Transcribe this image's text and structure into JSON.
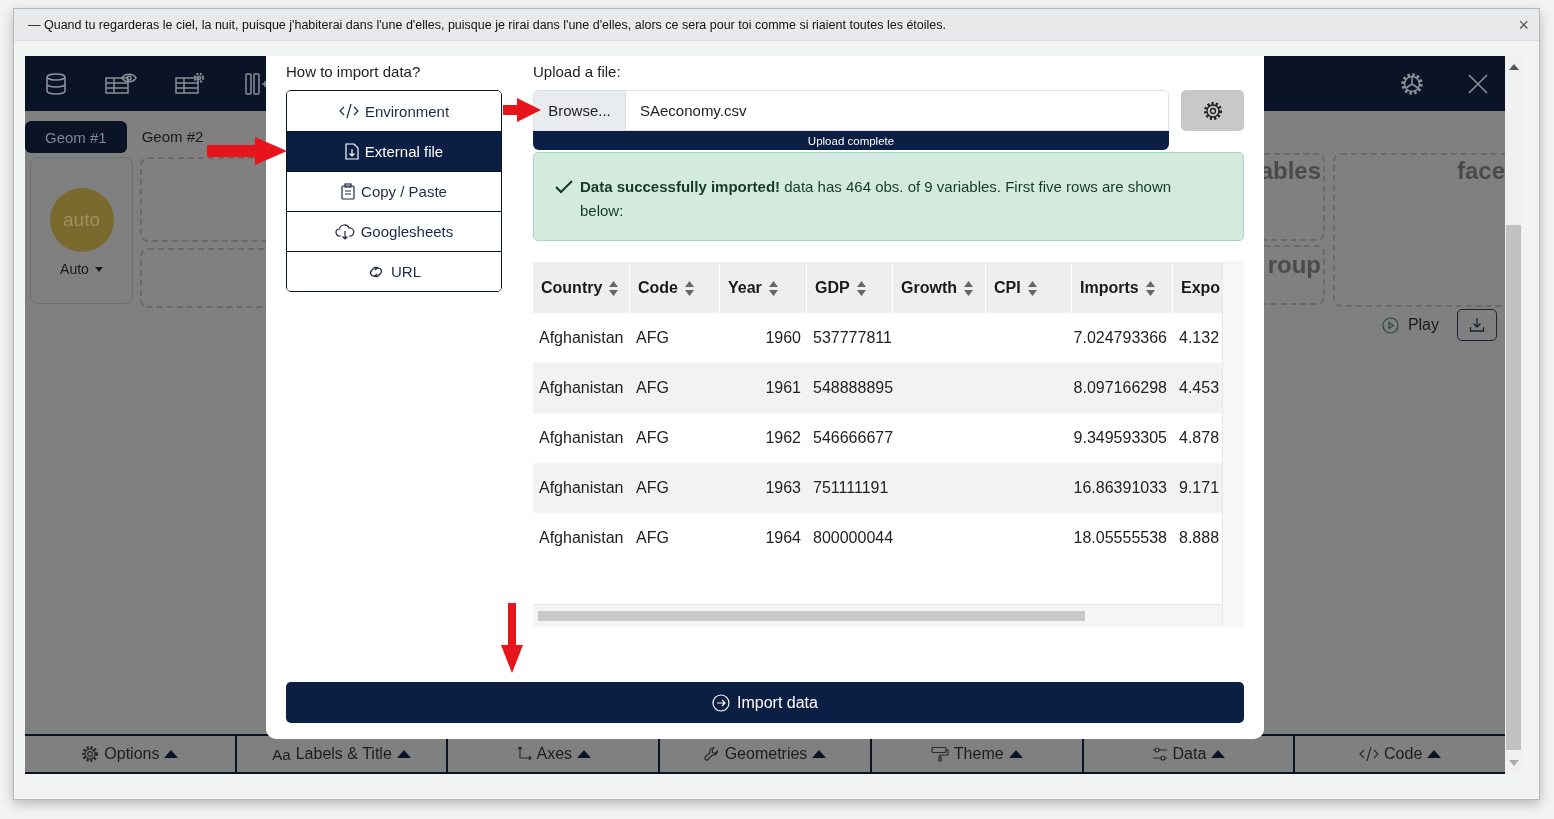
{
  "notice": {
    "text": "— Quand tu regarderas le ciel, la nuit, puisque j'habiterai dans l'une d'elles, puisque je rirai dans l'une d'elles, alors ce sera pour toi comme si riaient toutes les étoiles.",
    "close": "×"
  },
  "app": {
    "geom_tabs": [
      {
        "label": "Geom #1",
        "selected": true
      },
      {
        "label": "Geom #2",
        "selected": false
      }
    ],
    "geom_card": {
      "badge": "auto",
      "label": "Auto"
    },
    "drop_zones": [
      {
        "label": "ables"
      },
      {
        "label": "roup"
      },
      {
        "label": "face"
      }
    ],
    "play": "Play",
    "bottom_tabs": [
      {
        "kind": "options",
        "label": "Options"
      },
      {
        "kind": "labels",
        "glyph": "Aa",
        "label": "Labels & Title"
      },
      {
        "kind": "axes",
        "label": "Axes"
      },
      {
        "kind": "geometries",
        "label": "Geometries"
      },
      {
        "kind": "theme",
        "label": "Theme"
      },
      {
        "kind": "data",
        "label": "Data"
      },
      {
        "kind": "code",
        "label": "Code"
      }
    ]
  },
  "dialog": {
    "methods_title": "How to import data?",
    "methods": [
      {
        "kind": "environment",
        "label": "Environment",
        "selected": false
      },
      {
        "kind": "file",
        "label": "External file",
        "selected": true
      },
      {
        "kind": "paste",
        "label": "Copy / Paste",
        "selected": false
      },
      {
        "kind": "sheets",
        "label": "Googlesheets",
        "selected": false
      },
      {
        "kind": "url",
        "label": "URL",
        "selected": false
      }
    ],
    "upload_title": "Upload a file:",
    "browse": "Browse...",
    "file_name": "SAeconomy.csv",
    "progress": {
      "label": "Upload complete",
      "level": 1
    },
    "alert": "**Data successfully imported!** data has 464 obs. of 9 variables. First five rows are shown below:",
    "table": {
      "columns": [
        "Country",
        "Code",
        "Year",
        "GDP",
        "Growth",
        "CPI",
        "Imports",
        "Expo"
      ],
      "rows": [
        {
          "country": "Afghanistan",
          "code": "AFG",
          "year": "1960",
          "gdp": "537777811",
          "imports": "7.024793366",
          "expo": "4.132"
        },
        {
          "country": "Afghanistan",
          "code": "AFG",
          "year": "1961",
          "gdp": "548888895",
          "imports": "8.097166298",
          "expo": "4.453"
        },
        {
          "country": "Afghanistan",
          "code": "AFG",
          "year": "1962",
          "gdp": "546666677",
          "imports": "9.349593305",
          "expo": "4.878"
        },
        {
          "country": "Afghanistan",
          "code": "AFG",
          "year": "1963",
          "gdp": "751111191",
          "imports": "16.86391033",
          "expo": "9.171"
        },
        {
          "country": "Afghanistan",
          "code": "AFG",
          "year": "1964",
          "gdp": "800000044",
          "imports": "18.05555538",
          "expo": "8.888"
        }
      ]
    },
    "import_button": "Import data"
  }
}
